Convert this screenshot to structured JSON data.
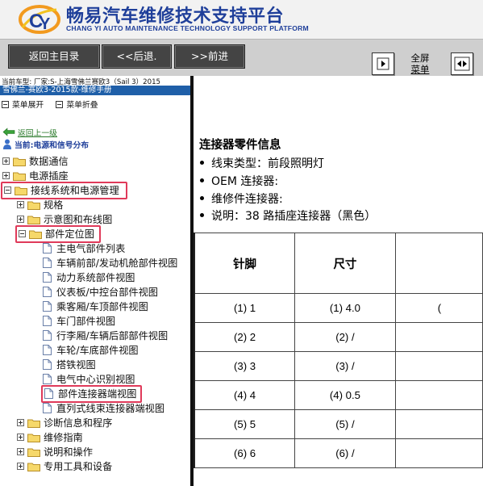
{
  "header": {
    "brand_cn": "畅易汽车维修技术支持平台",
    "brand_en": "CHANG YI AUTO MAINTENANCE TECHNOLOGY SUPPORT PLATFORM"
  },
  "toolbar": {
    "home_label": "返回主目录",
    "back_label": "<<后退.",
    "forward_label": ">>前进",
    "fullscreen_line1": "全屏",
    "fullscreen_line2": "菜单"
  },
  "sidebar": {
    "model_line": "当前车型:  厂家:S-上海雪佛兰赛欧3（Sail 3）2015",
    "manual_title": "雪佛兰-赛欧3-2015款-维修手册",
    "expand_all": "菜单展开",
    "collapse_all": "菜单折叠",
    "up_link": "返回上一级",
    "current": "当前:电源和信号分布",
    "tree": {
      "n1": "数据通信",
      "n2": "电源插座",
      "n3": "接线系统和电源管理",
      "n3a": "规格",
      "n3b": "示意图和布线图",
      "n3c": "部件定位图",
      "d1": "主电气部件列表",
      "d2": "车辆前部/发动机舱部件视图",
      "d3": "动力系统部件视图",
      "d4": "仪表板/中控台部件视图",
      "d5": "乘客厢/车顶部件视图",
      "d6": "车门部件视图",
      "d7": "行李厢/车辆后部部件视图",
      "d8": "车轮/车底部件视图",
      "d9": "搭铁视图",
      "d10": "电气中心识别视图",
      "d11": "部件连接器端视图",
      "d12": "直列式线束连接器端视图",
      "n4": "诊断信息和程序",
      "n5": "维修指南",
      "n6": "说明和操作",
      "n7": "专用工具和设备"
    }
  },
  "content": {
    "section_title": "连接器零件信息",
    "bullets": {
      "b1": "线束类型：前段照明灯",
      "b2": "OEM 连接器:",
      "b3": "维修件连接器:",
      "b4": "说明：38 路插座连接器（黑色）"
    },
    "table": {
      "headers": {
        "pin": "针脚",
        "size": "尺寸",
        "col3": ""
      },
      "rows": {
        "r1": {
          "pin": "(1) 1",
          "size": "(1) 4.0",
          "col3": "("
        },
        "r2": {
          "pin": "(2) 2",
          "size": "(2) /",
          "col3": ""
        },
        "r3": {
          "pin": "(3) 3",
          "size": "(3) /",
          "col3": ""
        },
        "r4": {
          "pin": "(4) 4",
          "size": "(4) 0.5",
          "col3": ""
        },
        "r5": {
          "pin": "(5) 5",
          "size": "(5) /",
          "col3": ""
        },
        "r6": {
          "pin": "(6) 6",
          "size": "(6) /",
          "col3": ""
        }
      }
    }
  },
  "colors": {
    "brand_blue": "#1f3f9a",
    "highlight": "#e03a5a",
    "manual_bar": "#1f5fa8",
    "toolbar_button": "#444444"
  },
  "icons": {
    "logo": "changyi-logo-icon",
    "folder": "folder-icon",
    "document": "document-icon",
    "back_arrow": "green-back-arrow-icon",
    "person": "person-icon"
  }
}
